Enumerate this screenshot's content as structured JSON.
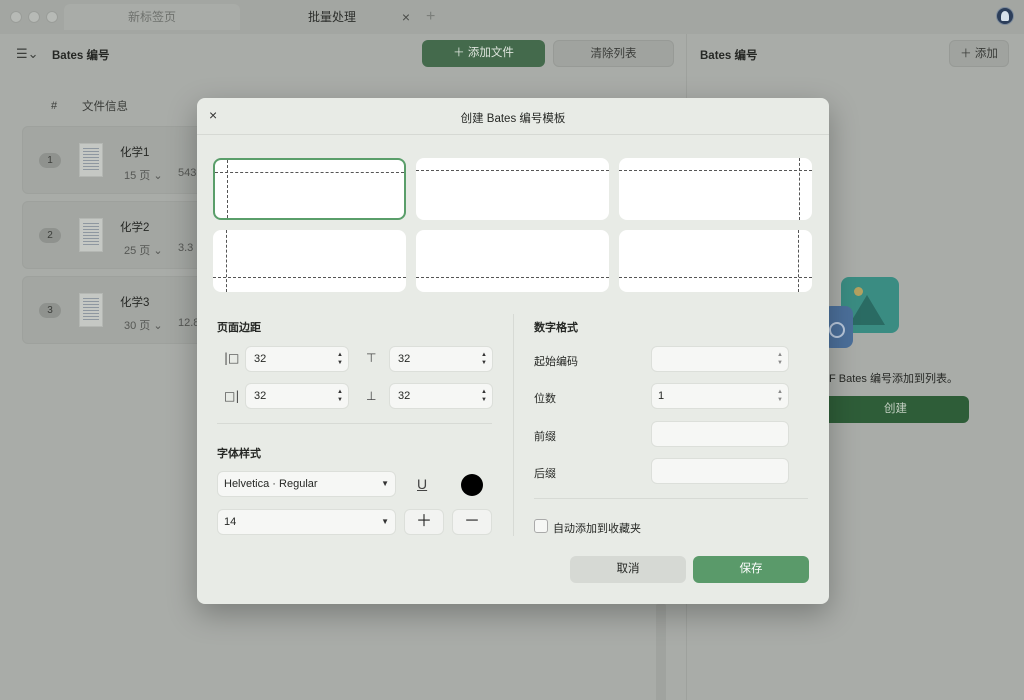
{
  "tabs": {
    "inactive_label": "新标签页",
    "active_label": "批量处理",
    "close_glyph": "×",
    "new_tab_glyph": "+"
  },
  "left_panel": {
    "menu_glyph": "☰⌄",
    "title": "Bates 编号",
    "add_files_label": "＋  添加文件",
    "clear_list_label": "清除列表",
    "col_number": "#",
    "col_file_info": "文件信息",
    "files": [
      {
        "num": "1",
        "name": "化学1",
        "pages": "15 页 ⌄",
        "size": "543"
      },
      {
        "num": "2",
        "name": "化学2",
        "pages": "25 页 ⌄",
        "size": "3.3"
      },
      {
        "num": "3",
        "name": "化学3",
        "pages": "30 页 ⌄",
        "size": "12.8"
      }
    ]
  },
  "right_panel": {
    "title": "Bates 编号",
    "add_label": "＋  添加",
    "hint_text": "F Bates 编号添加到列表。",
    "create_label": "创建"
  },
  "modal": {
    "close_glyph": "×",
    "title": "创建 Bates 编号模板",
    "margins": {
      "section_label": "页面边距",
      "left_value": "32",
      "top_value": "32",
      "right_value": "32",
      "bottom_value": "32"
    },
    "font": {
      "section_label": "字体样式",
      "family_value": "Helvetica · Regular",
      "size_value": "14",
      "increase_glyph": "＋",
      "decrease_glyph": "－",
      "underline_glyph": "U",
      "color": "#000000"
    },
    "number_format": {
      "section_label": "数字格式",
      "start_label": "起始编码",
      "start_value": "",
      "digits_label": "位数",
      "digits_value": "1",
      "prefix_label": "前缀",
      "prefix_value": "",
      "suffix_label": "后缀",
      "suffix_value": ""
    },
    "auto_add_label": "自动添加到收藏夹",
    "cancel_label": "取消",
    "save_label": "保存"
  },
  "colors": {
    "accent_green": "#5a9a6a",
    "dimmed_background": "#a9aca8",
    "modal_background": "#e8ebe6"
  }
}
